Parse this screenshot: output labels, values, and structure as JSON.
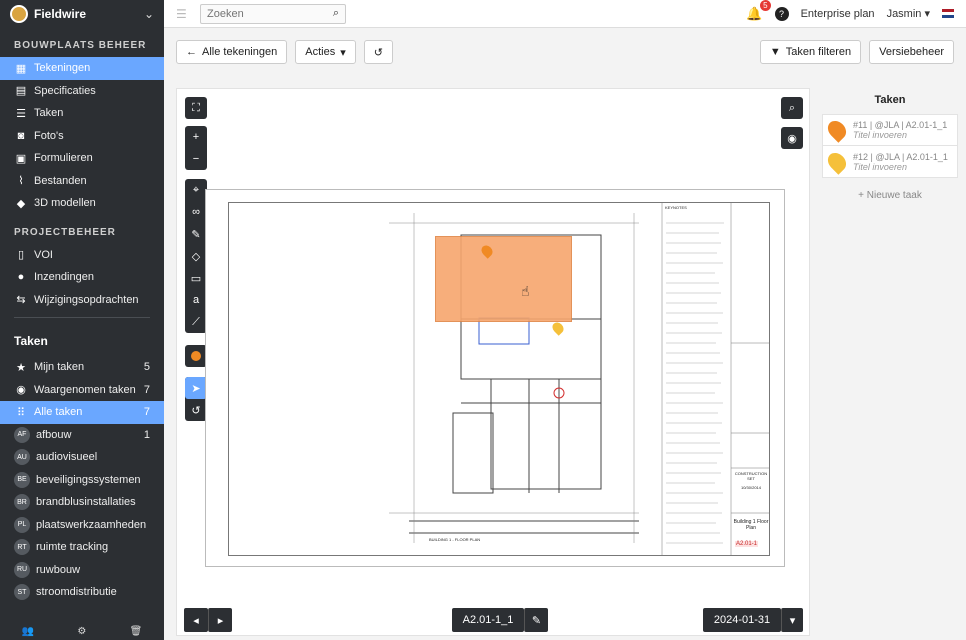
{
  "app": {
    "name": "Fieldwire"
  },
  "sidebar": {
    "section1": "BOUWPLAATS BEHEER",
    "items1": [
      {
        "label": "Tekeningen",
        "icon": "drawing-icon"
      },
      {
        "label": "Specificaties",
        "icon": "book-icon"
      },
      {
        "label": "Taken",
        "icon": "list-icon"
      },
      {
        "label": "Foto's",
        "icon": "camera-icon"
      },
      {
        "label": "Formulieren",
        "icon": "clipboard-icon"
      },
      {
        "label": "Bestanden",
        "icon": "paperclip-icon"
      },
      {
        "label": "3D modellen",
        "icon": "cube-icon"
      }
    ],
    "section2": "PROJECTBEHEER",
    "items2": [
      {
        "label": "VOI",
        "icon": "document-icon"
      },
      {
        "label": "Inzendingen",
        "icon": "user-icon"
      },
      {
        "label": "Wijzigingsopdrachten",
        "icon": "swap-icon"
      }
    ],
    "tasks_title": "Taken",
    "tasks": [
      {
        "label": "Mijn taken",
        "count": "5",
        "icon": "star-icon"
      },
      {
        "label": "Waargenomen taken",
        "count": "7",
        "icon": "eye-icon"
      },
      {
        "label": "Alle taken",
        "count": "7",
        "icon": "grid-icon"
      }
    ],
    "groups": [
      {
        "abbr": "AF",
        "label": "afbouw",
        "count": "1"
      },
      {
        "abbr": "AU",
        "label": "audiovisueel",
        "count": ""
      },
      {
        "abbr": "BE",
        "label": "beveiligingssystemen",
        "count": ""
      },
      {
        "abbr": "BR",
        "label": "brandblusinstallaties",
        "count": ""
      },
      {
        "abbr": "PL",
        "label": "plaatswerkzaamheden",
        "count": ""
      },
      {
        "abbr": "RT",
        "label": "ruimte tracking",
        "count": ""
      },
      {
        "abbr": "RU",
        "label": "ruwbouw",
        "count": ""
      },
      {
        "abbr": "ST",
        "label": "stroomdistributie",
        "count": ""
      }
    ]
  },
  "topbar": {
    "search_placeholder": "Zoeken",
    "notifications": "5",
    "plan": "Enterprise plan",
    "user": "Jasmin"
  },
  "toolbar": {
    "back": "Alle tekeningen",
    "actions": "Acties",
    "filter": "Taken filteren",
    "versions": "Versiebeheer"
  },
  "viewer": {
    "sheet_name": "A2.01-1_1",
    "date": "2024-01-31",
    "title_block": {
      "keynotes": "KEYNOTES",
      "set": "CONSTRUCTION SET",
      "set_date": "10/30/2014",
      "sheet_title": "Building 1 Floor Plan",
      "sheet_no": "A2.01-1",
      "plan_label": "BUILDING 1 - FLOOR PLAN"
    }
  },
  "tasks_panel": {
    "title": "Taken",
    "items": [
      {
        "meta": "#11 | @JLA | A2.01-1_1",
        "name": "Titel invoeren",
        "color": "#f08a24"
      },
      {
        "meta": "#12 | @JLA | A2.01-1_1",
        "name": "Titel invoeren",
        "color": "#f5c03a"
      }
    ],
    "new_task": "+ Nieuwe taak"
  },
  "colors": {
    "accent": "#6aa7ff",
    "sidebar": "#2c2f33",
    "area": "#f7a66d"
  }
}
